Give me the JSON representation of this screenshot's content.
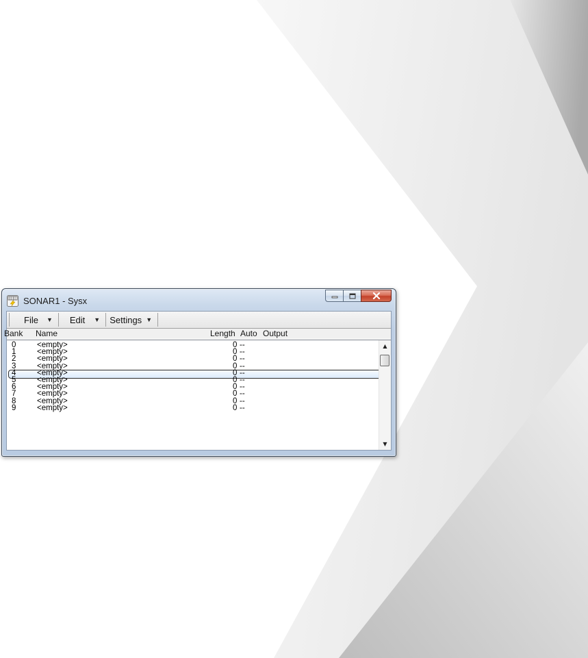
{
  "window": {
    "title": "SONAR1 - Sysx"
  },
  "menu": {
    "file": "File",
    "edit": "Edit",
    "settings": "Settings"
  },
  "columns": {
    "bank": "Bank",
    "name": "Name",
    "length": "Length",
    "auto": "Auto",
    "output": "Output"
  },
  "rows": [
    {
      "bank": "0",
      "name": "<empty>",
      "length": "0",
      "auto": "--"
    },
    {
      "bank": "1",
      "name": "<empty>",
      "length": "0",
      "auto": "--"
    },
    {
      "bank": "2",
      "name": "<empty>",
      "length": "0",
      "auto": "--"
    },
    {
      "bank": "3",
      "name": "<empty>",
      "length": "0",
      "auto": "--"
    },
    {
      "bank": "4",
      "name": "<empty>",
      "length": "0",
      "auto": "--"
    },
    {
      "bank": "5",
      "name": "<empty>",
      "length": "0",
      "auto": "--"
    },
    {
      "bank": "6",
      "name": "<empty>",
      "length": "0",
      "auto": "--"
    },
    {
      "bank": "7",
      "name": "<empty>",
      "length": "0",
      "auto": "--"
    },
    {
      "bank": "8",
      "name": "<empty>",
      "length": "0",
      "auto": "--"
    },
    {
      "bank": "9",
      "name": "<empty>",
      "length": "0",
      "auto": "--"
    }
  ],
  "selected_row": "4",
  "colors": {
    "close_button": "#c3422a",
    "title_bar": "#c9d8ea"
  }
}
